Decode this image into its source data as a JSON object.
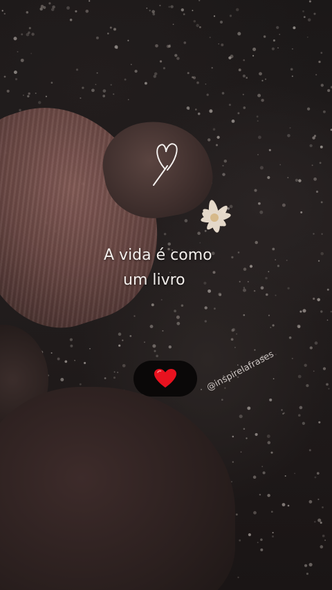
{
  "quote": {
    "line1": "A vida é como",
    "line2": "um livro"
  },
  "handle": "@inspirelafrases",
  "icons": {
    "outline_heart": "heart-outline-icon",
    "reaction_heart": "red-heart-icon"
  },
  "colors": {
    "text": "#f3efec",
    "heart": "#e8121f",
    "pill": "#0a0808"
  }
}
